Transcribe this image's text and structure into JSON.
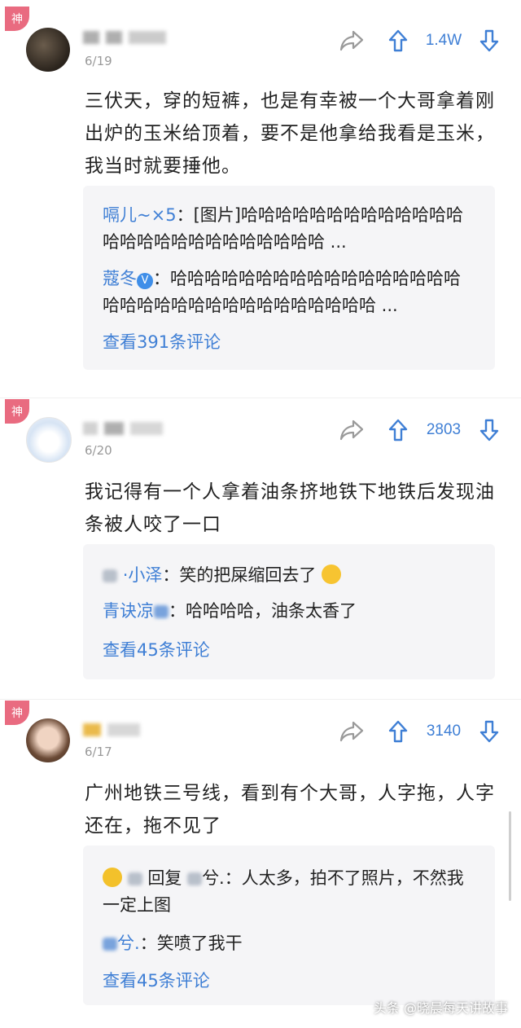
{
  "comments": [
    {
      "badge": "神",
      "date": "6/19",
      "votes": "1.4W",
      "text": "三伏天，穿的短裤，也是有幸被一个大哥拿着刚出炉的玉米给顶着，要不是他拿给我看是玉米，我当时就要捶他。",
      "replies": [
        {
          "nick": "嗝儿~×5",
          "sep": "：",
          "text": "[图片]哈哈哈哈哈哈哈哈哈哈哈哈哈哈哈哈哈哈哈哈哈哈哈哈哈哈 ..."
        },
        {
          "nick": "蔻冬",
          "verified": "V",
          "sep": "：",
          "text": "哈哈哈哈哈哈哈哈哈哈哈哈哈哈哈哈哈哈哈哈哈哈哈哈哈哈哈哈哈哈哈哈哈 ..."
        }
      ],
      "more": "查看391条评论"
    },
    {
      "badge": "神",
      "date": "6/20",
      "votes": "2803",
      "text": "我记得有一个人拿着油条挤地铁下地铁后发现油条被人咬了一口",
      "replies": [
        {
          "nick": "·小泽",
          "sep": "：",
          "text": "笑的把屎缩回去了"
        },
        {
          "nick": "青诀凉",
          "sep": "：",
          "text": "哈哈哈哈，油条太香了"
        }
      ],
      "more": "查看45条评论"
    },
    {
      "badge": "神",
      "date": "6/17",
      "votes": "3140",
      "text": "广州地铁三号线，看到有个大哥，人字拖，人字还在，拖不见了",
      "replies": [
        {
          "reply_word": "回复",
          "nick2": "兮.",
          "sep": "：",
          "text": "人太多，拍不了照片，不然我一定上图"
        },
        {
          "nick": "兮.",
          "sep": "：",
          "text": "笑喷了我干"
        }
      ],
      "more": "查看45条评论"
    }
  ],
  "watermark": "头条 @晓晨每天讲故事",
  "colors": {
    "accent": "#3f7fd5",
    "badge": "#e96b80",
    "reply_bg": "#f5f5f7"
  }
}
